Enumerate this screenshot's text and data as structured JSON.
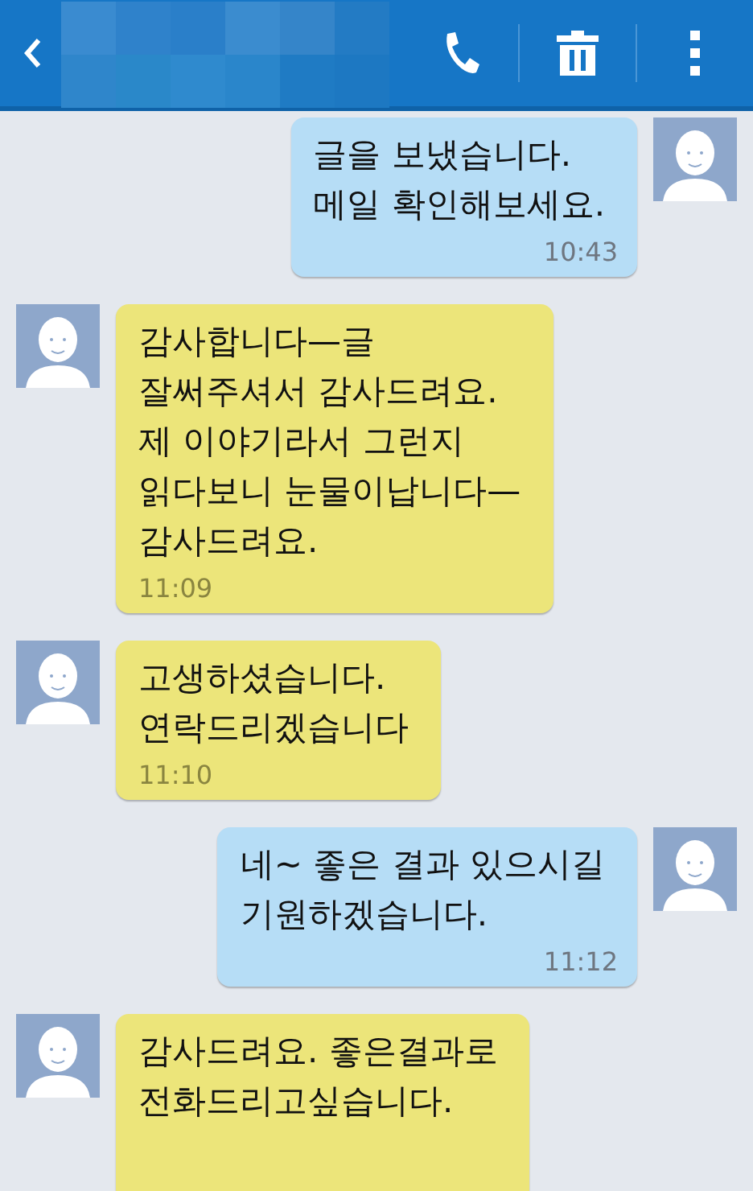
{
  "messages": [
    {
      "kind": "sent",
      "text": "글을 보냈습니다.\n메일 확인해보세요.",
      "time": "10:43"
    },
    {
      "kind": "received",
      "text": "감사합니다—글\n잘써주셔서 감사드려요.\n제 이야기라서 그런지\n읽다보니 눈물이납니다—\n감사드려요.",
      "time": "11:09"
    },
    {
      "kind": "received",
      "text": "고생하셨습니다.\n연락드리겠습니다",
      "time": "11:10"
    },
    {
      "kind": "sent",
      "text": "네~ 좋은 결과 있으시길\n기원하겠습니다.",
      "time": "11:12"
    },
    {
      "kind": "received",
      "text": "감사드려요. 좋은결과로\n전화드리고싶습니다."
    }
  ]
}
